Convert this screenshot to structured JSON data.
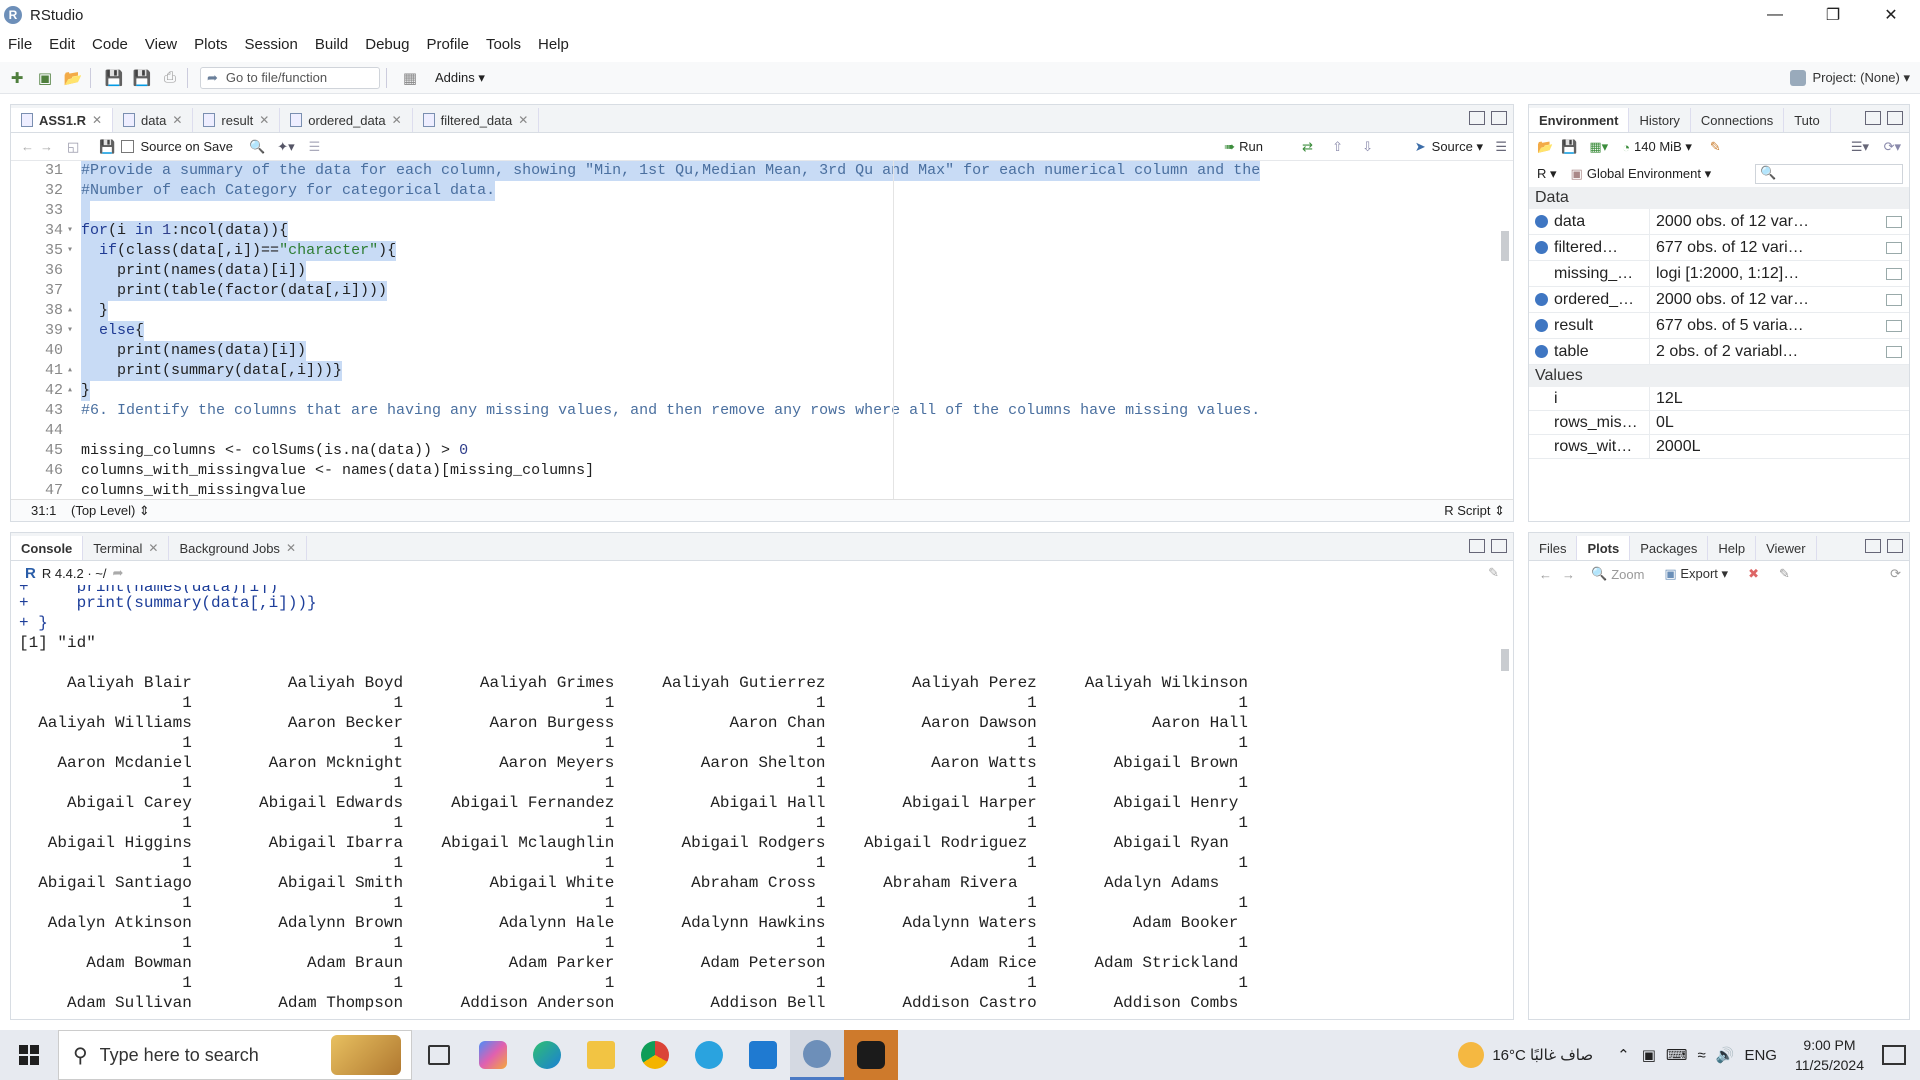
{
  "window": {
    "title": "RStudio"
  },
  "menu": [
    "File",
    "Edit",
    "Code",
    "View",
    "Plots",
    "Session",
    "Build",
    "Debug",
    "Profile",
    "Tools",
    "Help"
  ],
  "toolbar": {
    "goto_placeholder": "Go to file/function",
    "addins": "Addins",
    "project": "Project: (None)"
  },
  "editor": {
    "tabs": [
      {
        "label": "ASS1.R",
        "active": true
      },
      {
        "label": "data"
      },
      {
        "label": "result"
      },
      {
        "label": "ordered_data"
      },
      {
        "label": "filtered_data"
      }
    ],
    "source_on_save": "Source on Save",
    "run": "Run",
    "source": "Source",
    "cursor_pos": "31:1",
    "scope": "(Top Level)",
    "file_type": "R Script"
  },
  "console": {
    "tabs": [
      {
        "label": "Console",
        "active": true
      },
      {
        "label": "Terminal"
      },
      {
        "label": "Background Jobs"
      }
    ],
    "r_version": "R 4.4.2 · ~/"
  },
  "env": {
    "tabs": [
      "Environment",
      "History",
      "Connections",
      "Tuto"
    ],
    "memory": "140 MiB",
    "lang": "R",
    "scope": "Global Environment",
    "data_header": "Data",
    "values_header": "Values",
    "data": [
      {
        "name": "data",
        "value": "2000 obs. of 12 var…",
        "dot": true
      },
      {
        "name": "filtered…",
        "value": "677 obs. of 12 vari…",
        "dot": true
      },
      {
        "name": "missing_…",
        "value": "logi [1:2000, 1:12]…",
        "dot": false
      },
      {
        "name": "ordered_…",
        "value": "2000 obs. of 12 var…",
        "dot": true
      },
      {
        "name": "result",
        "value": "677 obs. of 5 varia…",
        "dot": true
      },
      {
        "name": "table",
        "value": "2 obs. of 2 variabl…",
        "dot": true
      }
    ],
    "values": [
      {
        "name": "i",
        "value": "12L"
      },
      {
        "name": "rows_mis…",
        "value": "0L"
      },
      {
        "name": "rows_wit…",
        "value": "2000L"
      }
    ]
  },
  "files": {
    "tabs": [
      "Files",
      "Plots",
      "Packages",
      "Help",
      "Viewer"
    ],
    "zoom": "Zoom",
    "export": "Export"
  },
  "taskbar": {
    "search_placeholder": "Type here to search",
    "weather": "16°C صاف غالبًا",
    "lang": "ENG",
    "time": "9:00 PM",
    "date": "11/25/2024"
  }
}
